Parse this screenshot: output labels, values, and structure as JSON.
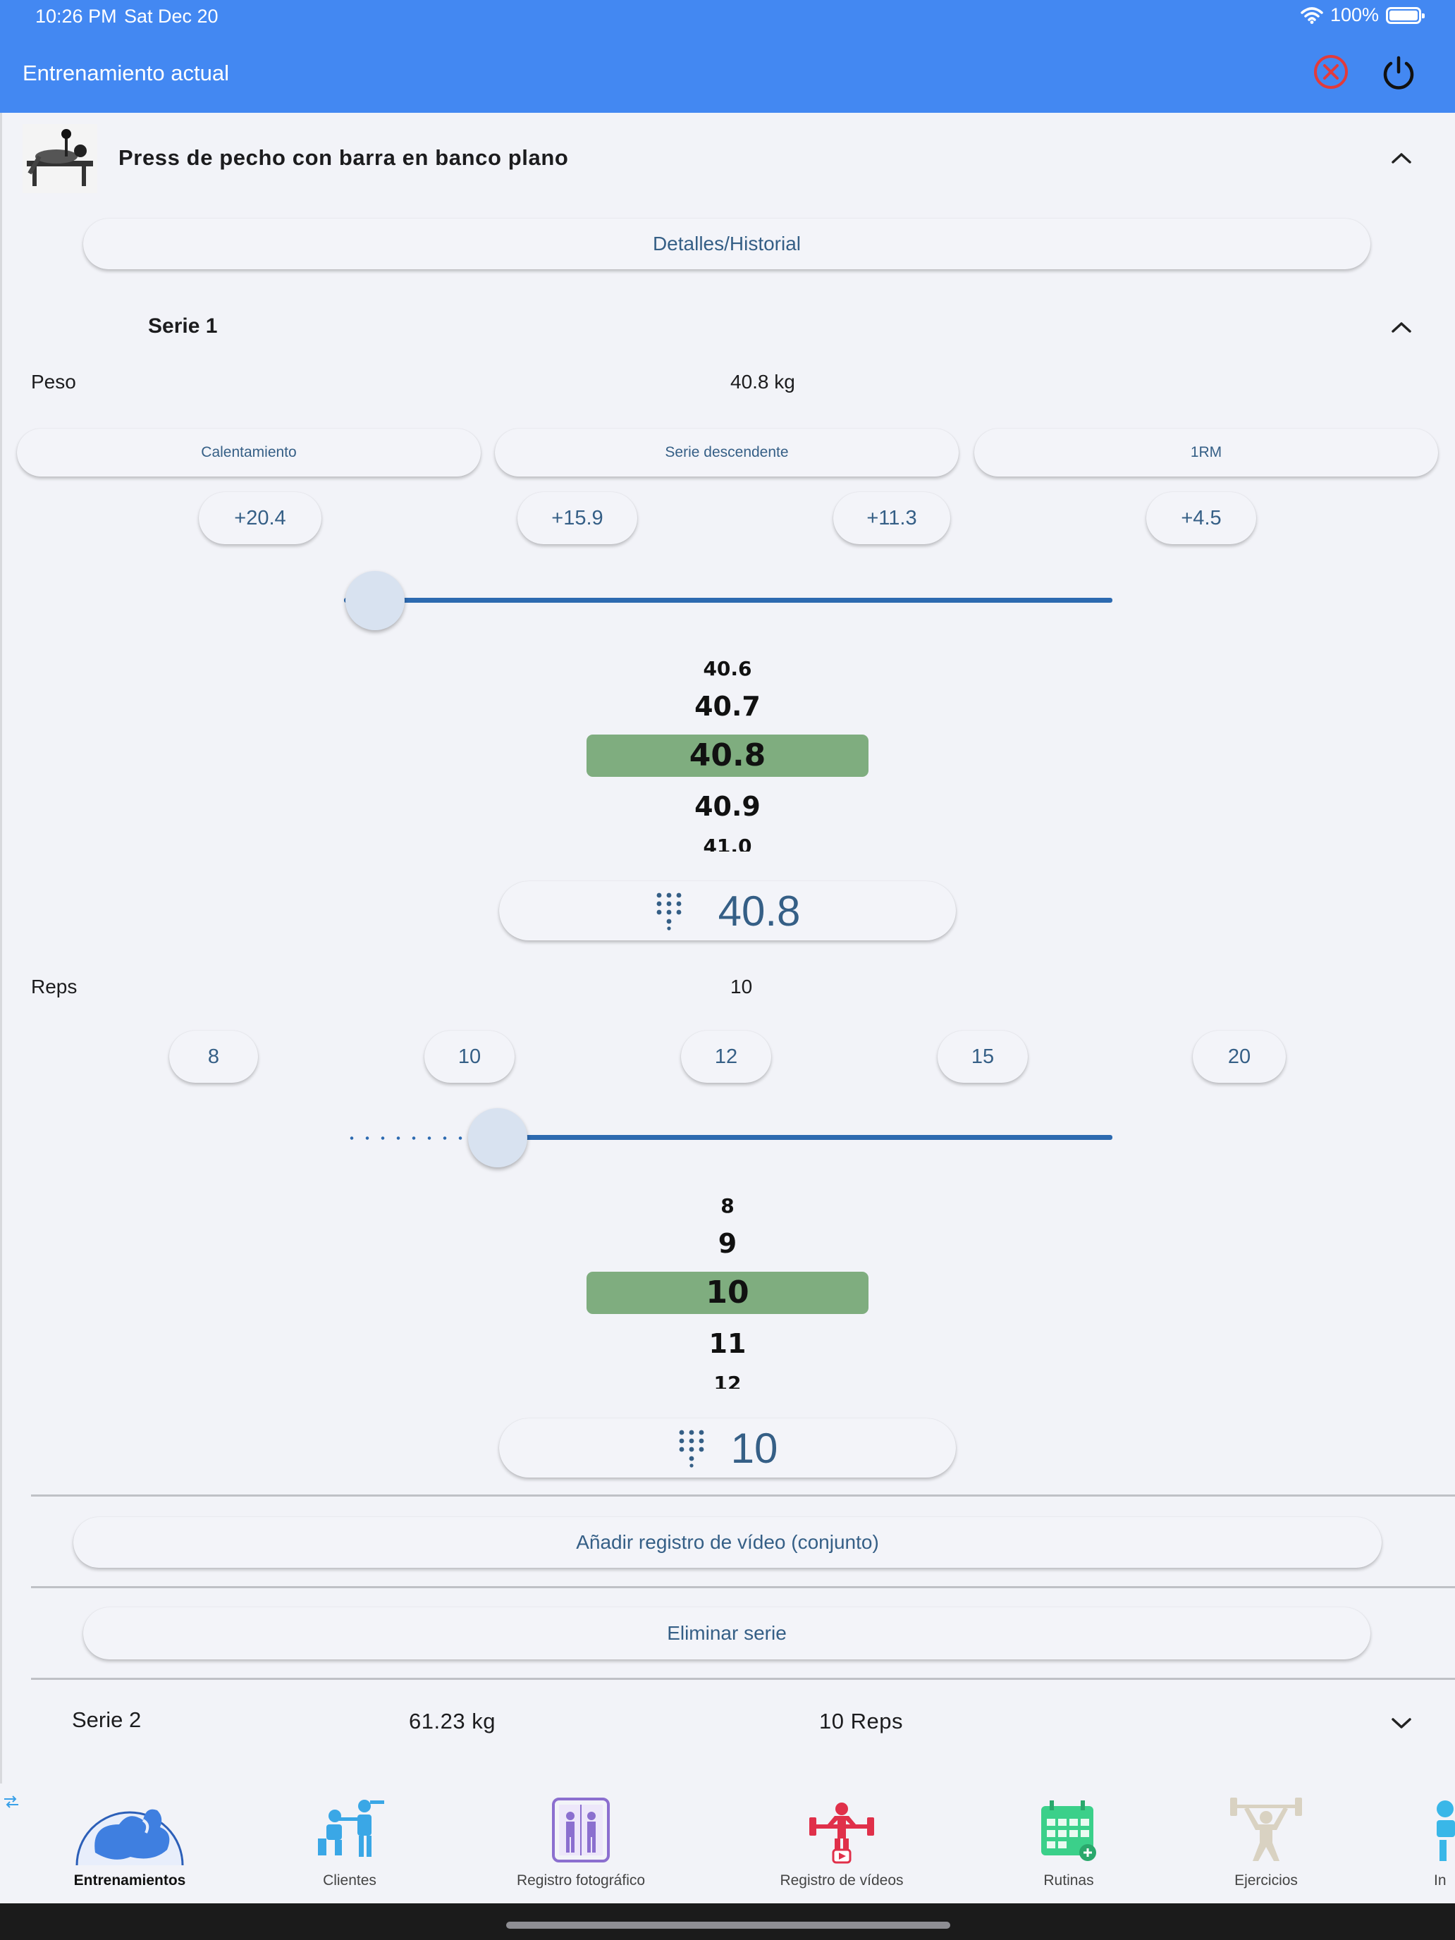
{
  "status_bar": {
    "time": "10:26 PM",
    "date": "Sat Dec 20",
    "battery": "100%"
  },
  "app_bar": {
    "title": "Entrenamiento actual"
  },
  "exercise": {
    "name": "Press de pecho con barra en banco plano",
    "details_button": "Detalles/Historial"
  },
  "set1": {
    "title": "Serie 1",
    "weight_label": "Peso",
    "weight_value": "40.8 kg",
    "set_types": [
      "Calentamiento",
      "Serie descendente",
      "1RM"
    ],
    "weight_increments": [
      "+20.4",
      "+15.9",
      "+11.3",
      "+4.5"
    ],
    "weight_slider_fraction": 0.04,
    "weight_wheel": [
      "40.6",
      "40.7",
      "40.8",
      "40.9",
      "41.0"
    ],
    "weight_input": "40.8",
    "reps_label": "Reps",
    "reps_value": "10",
    "reps_quick": [
      "8",
      "10",
      "12",
      "15",
      "20"
    ],
    "reps_slider_fraction": 0.2,
    "reps_wheel": [
      "8",
      "9",
      "10",
      "11",
      "12"
    ],
    "reps_input": "10",
    "video_button": "Añadir registro de vídeo (conjunto)",
    "delete_button": "Eliminar serie"
  },
  "set2": {
    "title": "Serie 2",
    "weight": "61.23 kg",
    "reps": "10 Reps"
  },
  "bottom_nav": [
    {
      "label": "Entrenamientos",
      "icon": "muscle-arm-icon",
      "color": "#3f7fe0"
    },
    {
      "label": "Clientes",
      "icon": "trainer-clients-icon",
      "color": "#3aa7e6"
    },
    {
      "label": "Registro fotográfico",
      "icon": "progress-photo-icon",
      "color": "#8b6fcf"
    },
    {
      "label": "Registro de vídeos",
      "icon": "weightlifter-video-icon",
      "color": "#e0304a"
    },
    {
      "label": "Rutinas",
      "icon": "calendar-routine-icon",
      "color": "#3bd08a"
    },
    {
      "label": "Ejercicios",
      "icon": "barbell-lifter-icon",
      "color": "#d9d2c2"
    },
    {
      "label": "In",
      "icon": "info-person-icon",
      "color": "#39b7e8"
    }
  ],
  "colors": {
    "app_bar": "#4388f2",
    "accent_text": "#355f86",
    "wheel_selected": "#7fad7f",
    "slider": "#2d6ab0"
  }
}
